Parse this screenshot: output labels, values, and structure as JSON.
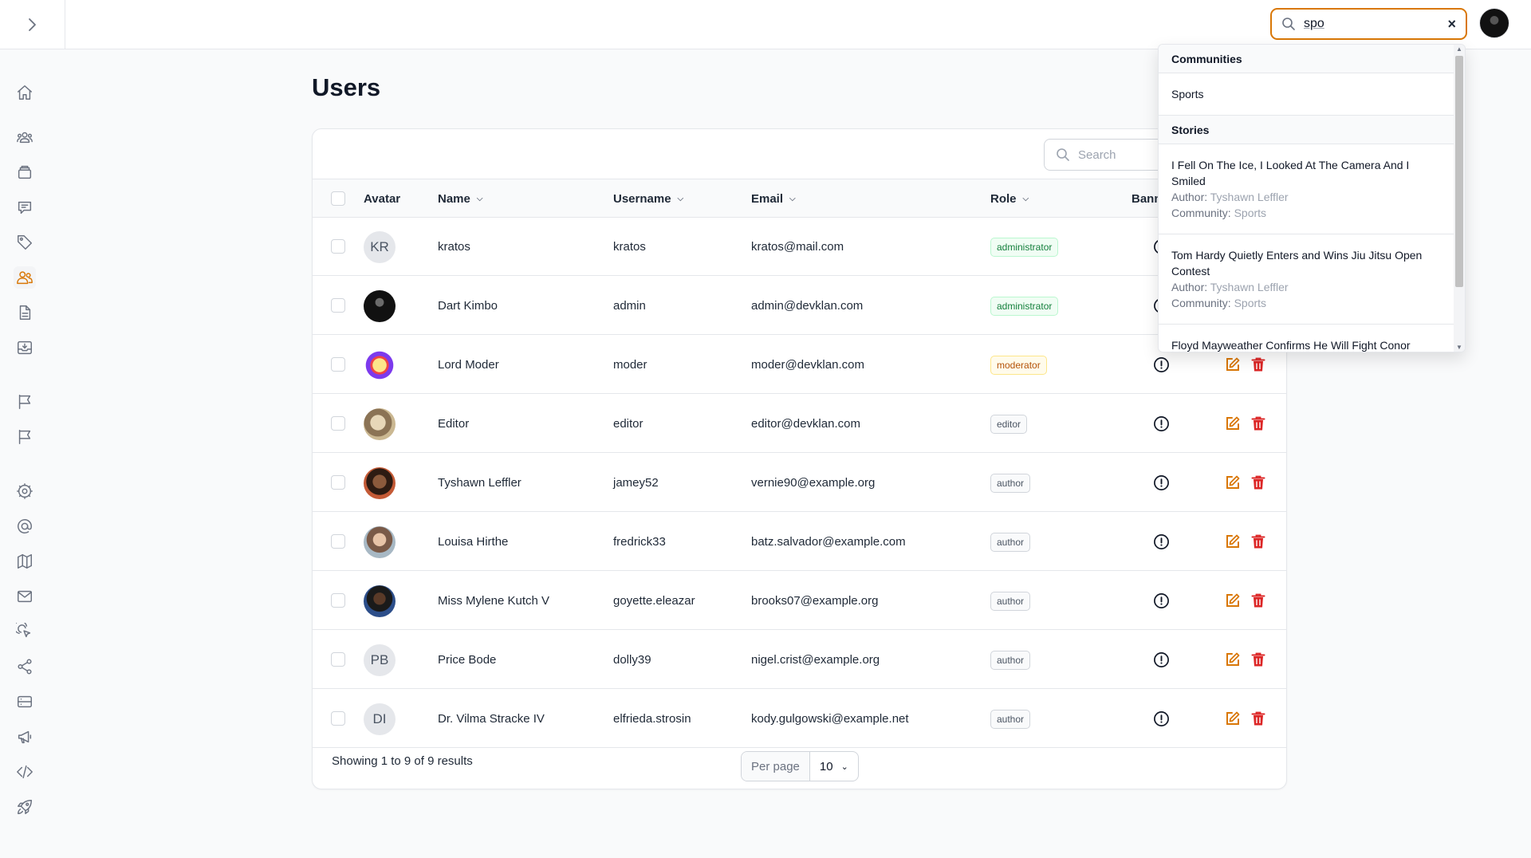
{
  "topbar": {
    "global_search_value": "spo",
    "clear_symbol": "×"
  },
  "sidebar": {
    "items": [
      {
        "icon": "home-icon",
        "active": false
      },
      {
        "icon": "users-group-icon",
        "active": false
      },
      {
        "icon": "archive-icon",
        "active": false
      },
      {
        "icon": "chat-icon",
        "active": false
      },
      {
        "icon": "tag-icon",
        "active": false
      },
      {
        "icon": "users-icon",
        "active": true
      },
      {
        "icon": "document-icon",
        "active": false
      },
      {
        "icon": "inbox-icon",
        "active": false
      },
      {
        "icon": "flag-icon",
        "active": false
      },
      {
        "icon": "flag-icon",
        "active": false
      },
      {
        "icon": "cog-icon",
        "active": false
      },
      {
        "icon": "at-sign-icon",
        "active": false
      },
      {
        "icon": "map-icon",
        "active": false
      },
      {
        "icon": "mail-icon",
        "active": false
      },
      {
        "icon": "cursor-click-icon",
        "active": false
      },
      {
        "icon": "share-icon",
        "active": false
      },
      {
        "icon": "server-icon",
        "active": false
      },
      {
        "icon": "megaphone-icon",
        "active": false
      },
      {
        "icon": "code-icon",
        "active": false
      },
      {
        "icon": "rocket-icon",
        "active": false
      }
    ]
  },
  "page": {
    "title": "Users"
  },
  "table": {
    "search_placeholder": "Search",
    "columns": {
      "avatar": "Avatar",
      "name": "Name",
      "username": "Username",
      "email": "Email",
      "role": "Role",
      "banned": "Bann"
    },
    "rows": [
      {
        "initials": "KR",
        "name": "kratos",
        "username": "kratos",
        "email": "kratos@mail.com",
        "role": "administrator",
        "avatar_style": "initials"
      },
      {
        "initials": "",
        "name": "Dart Kimbo",
        "username": "admin",
        "email": "admin@devklan.com",
        "role": "administrator",
        "avatar_style": "dark"
      },
      {
        "initials": "",
        "name": "Lord Moder",
        "username": "moder",
        "email": "moder@devklan.com",
        "role": "moderator",
        "avatar_style": "clown"
      },
      {
        "initials": "",
        "name": "Editor",
        "username": "editor",
        "email": "editor@devklan.com",
        "role": "editor",
        "avatar_style": "photo-tan"
      },
      {
        "initials": "",
        "name": "Tyshawn Leffler",
        "username": "jamey52",
        "email": "vernie90@example.org",
        "role": "author",
        "avatar_style": "photo-brown"
      },
      {
        "initials": "",
        "name": "Louisa Hirthe",
        "username": "fredrick33",
        "email": "batz.salvador@example.com",
        "role": "author",
        "avatar_style": "photo-light"
      },
      {
        "initials": "",
        "name": "Miss Mylene Kutch V",
        "username": "goyette.eleazar",
        "email": "brooks07@example.org",
        "role": "author",
        "avatar_style": "photo-dark"
      },
      {
        "initials": "PB",
        "name": "Price Bode",
        "username": "dolly39",
        "email": "nigel.crist@example.org",
        "role": "author",
        "avatar_style": "initials"
      },
      {
        "initials": "DI",
        "name": "Dr. Vilma Stracke IV",
        "username": "elfrieda.strosin",
        "email": "kody.gulgowski@example.net",
        "role": "author",
        "avatar_style": "initials"
      }
    ],
    "footer_text": "Showing 1 to 9 of 9 results",
    "per_page_label": "Per page",
    "per_page_value": "10"
  },
  "dropdown": {
    "communities_header": "Communities",
    "communities": [
      "Sports"
    ],
    "stories_header": "Stories",
    "author_label": "Author:",
    "community_label": "Community:",
    "stories": [
      {
        "title": "I Fell On The Ice, I Looked At The Camera And I Smiled",
        "author": "Tyshawn Leffler",
        "community": "Sports"
      },
      {
        "title": "Tom Hardy Quietly Enters and Wins Jiu Jitsu Open Contest",
        "author": "Tyshawn Leffler",
        "community": "Sports"
      },
      {
        "title": "Floyd Mayweather Confirms He Will Fight Conor",
        "author": "",
        "community": ""
      }
    ]
  },
  "colors": {
    "accent": "#d97706",
    "delete": "#dc2626",
    "admin_badge": "#15803d"
  }
}
